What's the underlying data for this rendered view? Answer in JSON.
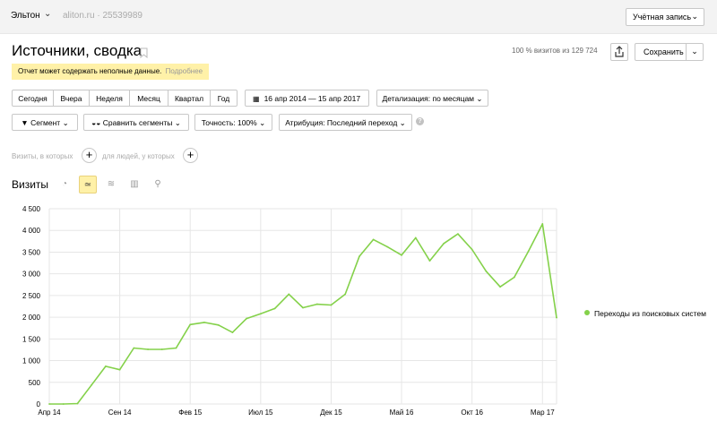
{
  "topbar": {
    "counter_name": "Эльтон",
    "site": "aliton.ru · 25539989",
    "account_label": "Учётная запись"
  },
  "header": {
    "title": "Источники, сводка",
    "visits_share": "100 % визитов из 129 724",
    "save_label": "Сохранить"
  },
  "warning": {
    "text": "Отчет может содержать неполные данные.",
    "more": "Подробнее"
  },
  "periods": [
    "Сегодня",
    "Вчера",
    "Неделя",
    "Месяц",
    "Квартал",
    "Год"
  ],
  "date_range": "16 апр 2014 — 15 апр 2017",
  "detail": "Детализация: по месяцам",
  "controls": {
    "segment": "Сегмент",
    "compare": "Сравнить сегменты",
    "accuracy": "Точность: 100%",
    "attribution": "Атрибуция: Последний переход"
  },
  "filters": {
    "visits_where": "Визиты, в которых",
    "people_where": "для людей, у которых"
  },
  "visits_title": "Визиты",
  "icons": [
    "pie-chart-icon",
    "line-chart-icon",
    "area-chart-icon",
    "bar-chart-icon",
    "map-icon"
  ],
  "colors": {
    "accent": "#fff1a8",
    "series": "#84d14a"
  },
  "chart_data": {
    "type": "line",
    "ylim": [
      0,
      4500
    ],
    "yticks": [
      "0",
      "500",
      "1 000",
      "1 500",
      "2 000",
      "2 500",
      "3 000",
      "3 500",
      "4 000",
      "4 500"
    ],
    "xtick_labels": [
      "Апр 14",
      "Сен 14",
      "Фев 15",
      "Июл 15",
      "Дек 15",
      "Май 16",
      "Окт 16",
      "Мар 17"
    ],
    "xtick_index": [
      0,
      5,
      10,
      15,
      20,
      25,
      30,
      35
    ],
    "grid": true,
    "legend": "right",
    "series": [
      {
        "name": "Переходы из поисковых систем",
        "values": [
          0,
          0,
          10,
          440,
          870,
          790,
          1290,
          1260,
          1260,
          1290,
          1830,
          1880,
          1820,
          1650,
          1970,
          2080,
          2200,
          2530,
          2220,
          2300,
          2280,
          2530,
          3400,
          3790,
          3620,
          3430,
          3830,
          3300,
          3700,
          3920,
          3560,
          3060,
          2700,
          2920,
          3520,
          4150,
          1990
        ]
      }
    ]
  }
}
